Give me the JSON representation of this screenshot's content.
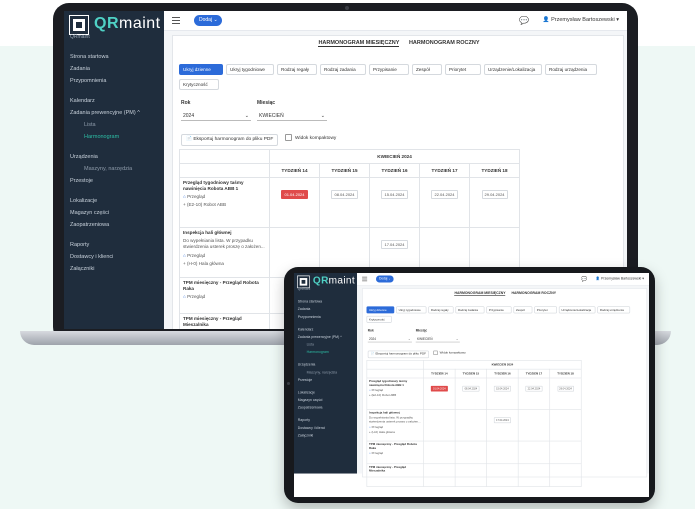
{
  "app": {
    "brand_prefix": "QR",
    "brand_suffix": "maint",
    "subtitle": "QRmaint"
  },
  "topbar": {
    "add_button": "Dodaj",
    "user": "Przemysław Bartoszewski"
  },
  "sidebar": {
    "items": [
      {
        "label": "Strona startowa",
        "type": "item"
      },
      {
        "label": "Zadania",
        "type": "item"
      },
      {
        "label": "Przypomnienia",
        "type": "item"
      },
      {
        "label": "Kalendarz",
        "type": "item"
      },
      {
        "label": "Zadania prewencyjne (PM) ^",
        "type": "item"
      },
      {
        "label": "Lista",
        "type": "sub"
      },
      {
        "label": "Harmonogram",
        "type": "sub-active"
      },
      {
        "label": "Urządzenia",
        "type": "item"
      },
      {
        "label": "Maszyny, narzędzia",
        "type": "sub"
      },
      {
        "label": "Przestoje",
        "type": "item"
      },
      {
        "label": "Lokalizacje",
        "type": "item"
      },
      {
        "label": "Magazyn części",
        "type": "item"
      },
      {
        "label": "Zaopatrzeniowa",
        "type": "item"
      },
      {
        "label": "Raporty",
        "type": "item"
      },
      {
        "label": "Dostawcy i klienci",
        "type": "item"
      },
      {
        "label": "Załączniki",
        "type": "item"
      }
    ]
  },
  "tabs": {
    "monthly": "HARMONOGRAM MIESIĘCZNY",
    "yearly": "HARMONOGRAM ROCZNY"
  },
  "filters": {
    "row1": [
      "Ukryj dzienne",
      "Ukryj tygodniowe",
      "Rodzaj regały",
      "Rodzaj zadania",
      "Przypisanie",
      "Zespół",
      "Priorytet",
      "Urządzenie/Lokalizacja",
      "Rodzaj urządzenia"
    ],
    "row2": [
      "Krytyczność"
    ]
  },
  "year": {
    "label": "Rok",
    "value": "2024"
  },
  "month": {
    "label": "Miesiąc",
    "value": "KWIECIEŃ"
  },
  "export_button": "Eksportuj harmonogram do pliku PDF",
  "compact_view": "Widok kompaktowy",
  "schedule": {
    "title": "KWIECIEŃ 2024",
    "weeks": [
      "TYDZIEŃ 14",
      "TYDZIEŃ 15",
      "TYDZIEŃ 16",
      "TYDZIEŃ 17",
      "TYDZIEŃ 18"
    ],
    "tasks": [
      {
        "title": "Przegląd tygodniowy taśmy nawinięcia Robota ABB 1",
        "desc": "",
        "type": "Przegląd",
        "location": "+ (E2-10) Robot ABB",
        "dates": [
          "01.04.2024",
          "08.04.2024",
          "15.04.2024",
          "22.04.2024",
          "29.04.2024"
        ]
      },
      {
        "title": "Inspekcja hali głównej",
        "desc": "Do wypełniania lista. W przypadku stwierdzenia usterek proszę o założen...",
        "type": "Przegląd",
        "location": "+ (H-0) Hala główna",
        "dates": [
          "",
          "",
          "17.04.2024",
          "",
          ""
        ]
      },
      {
        "title": "TPM miesięczny - Przegląd Robota Raka",
        "desc": "",
        "type": "Przegląd",
        "location": "",
        "dates": [
          "",
          "",
          "",
          "",
          ""
        ]
      },
      {
        "title": "TPM miesięczny - Przegląd Mieszalnika",
        "desc": "",
        "type": "",
        "location": "",
        "dates": [
          "",
          "",
          "",
          "",
          ""
        ]
      }
    ]
  }
}
